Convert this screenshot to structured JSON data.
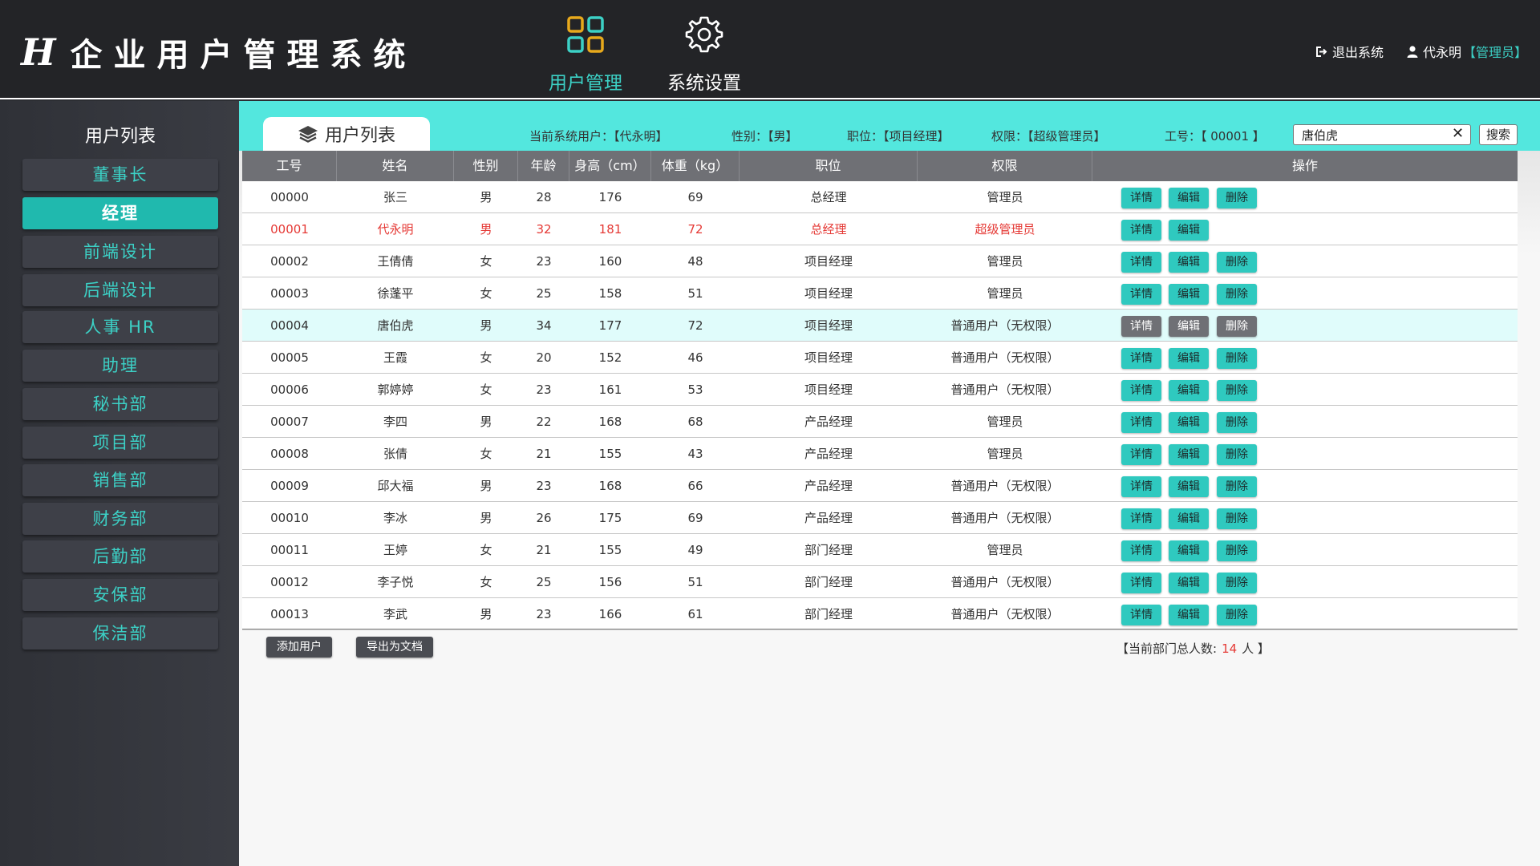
{
  "header": {
    "logo_mark": "H",
    "title": "企业用户管理系统",
    "nav": [
      {
        "label": "用户管理",
        "icon": "grid-icon"
      },
      {
        "label": "系统设置",
        "icon": "gear-icon"
      }
    ],
    "logout_label": "退出系统",
    "user_name": "代永明",
    "user_role": "【管理员】"
  },
  "sidebar": {
    "title": "用户列表",
    "items": [
      "董事长",
      "经理",
      "前端设计",
      "后端设计",
      "人事 HR",
      "助理",
      "秘书部",
      "项目部",
      "销售部",
      "财务部",
      "后勤部",
      "安保部",
      "保洁部"
    ],
    "active_index": 1
  },
  "tab": {
    "label": "用户列表",
    "icon": "layers-icon"
  },
  "info": {
    "current_user": "当前系统用户：【代永明】",
    "gender": "性别：【男】",
    "position": "职位：【项目经理】",
    "permission": "权限：【超级管理员】",
    "employee_id": "工号：【 00001 】"
  },
  "search": {
    "value": "唐伯虎",
    "clear": "✕",
    "button": "搜索"
  },
  "table": {
    "headers": [
      "工号",
      "姓名",
      "性别",
      "年龄",
      "身高（cm）",
      "体重（kg）",
      "职位",
      "权限",
      "操作"
    ],
    "actions": {
      "detail": "详情",
      "edit": "编辑",
      "delete": "删除"
    },
    "rows": [
      [
        "00000",
        "张三",
        "男",
        "28",
        "176",
        "69",
        "总经理",
        "管理员"
      ],
      [
        "00001",
        "代永明",
        "男",
        "32",
        "181",
        "72",
        "总经理",
        "超级管理员"
      ],
      [
        "00002",
        "王倩倩",
        "女",
        "23",
        "160",
        "48",
        "项目经理",
        "管理员"
      ],
      [
        "00003",
        "徐蓬平",
        "女",
        "25",
        "158",
        "51",
        "项目经理",
        "管理员"
      ],
      [
        "00004",
        "唐伯虎",
        "男",
        "34",
        "177",
        "72",
        "项目经理",
        "普通用户（无权限）"
      ],
      [
        "00005",
        "王霞",
        "女",
        "20",
        "152",
        "46",
        "项目经理",
        "普通用户（无权限）"
      ],
      [
        "00006",
        "郭婷婷",
        "女",
        "23",
        "161",
        "53",
        "项目经理",
        "普通用户（无权限）"
      ],
      [
        "00007",
        "李四",
        "男",
        "22",
        "168",
        "68",
        "产品经理",
        "管理员"
      ],
      [
        "00008",
        "张倩",
        "女",
        "21",
        "155",
        "43",
        "产品经理",
        "管理员"
      ],
      [
        "00009",
        "邱大福",
        "男",
        "23",
        "168",
        "66",
        "产品经理",
        "普通用户（无权限）"
      ],
      [
        "00010",
        "李冰",
        "男",
        "26",
        "175",
        "69",
        "产品经理",
        "普通用户（无权限）"
      ],
      [
        "00011",
        "王婷",
        "女",
        "21",
        "155",
        "49",
        "部门经理",
        "管理员"
      ],
      [
        "00012",
        "李子悦",
        "女",
        "25",
        "156",
        "51",
        "部门经理",
        "普通用户（无权限）"
      ],
      [
        "00013",
        "李武",
        "男",
        "23",
        "166",
        "61",
        "部门经理",
        "普通用户（无权限）"
      ]
    ],
    "current_user_row": 1,
    "highlighted_row": 4
  },
  "footer": {
    "add_user": "添加用户",
    "export": "导出为文档",
    "count_prefix": "【当前部门总人数:",
    "count_value": "14",
    "count_suffix": "人 】"
  },
  "colors": {
    "accent": "#3cd1c6",
    "topbar": "#53e7de",
    "header": "#232427",
    "danger": "#e53935"
  }
}
